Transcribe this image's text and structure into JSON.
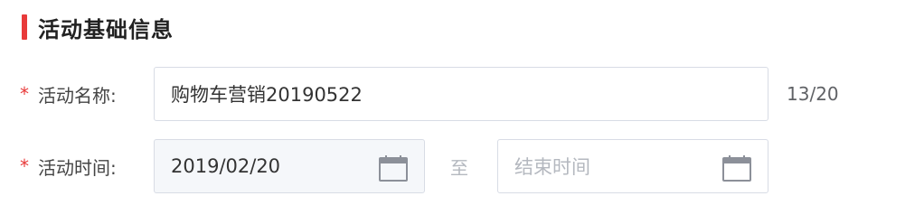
{
  "section": {
    "title": "活动基础信息"
  },
  "form": {
    "name": {
      "required_mark": "*",
      "label": "活动名称:",
      "value": "购物车营销20190522",
      "count": "13/20"
    },
    "time": {
      "required_mark": "*",
      "label": "活动时间:",
      "start_value": "2019/02/20",
      "separator": "至",
      "end_placeholder": "结束时间"
    }
  },
  "colors": {
    "accent": "#e83a3a",
    "border": "#d8dce5",
    "disabled_bg": "#f5f7fa",
    "placeholder": "#b4b8bf"
  },
  "icons": {
    "calendar": "calendar-icon"
  }
}
